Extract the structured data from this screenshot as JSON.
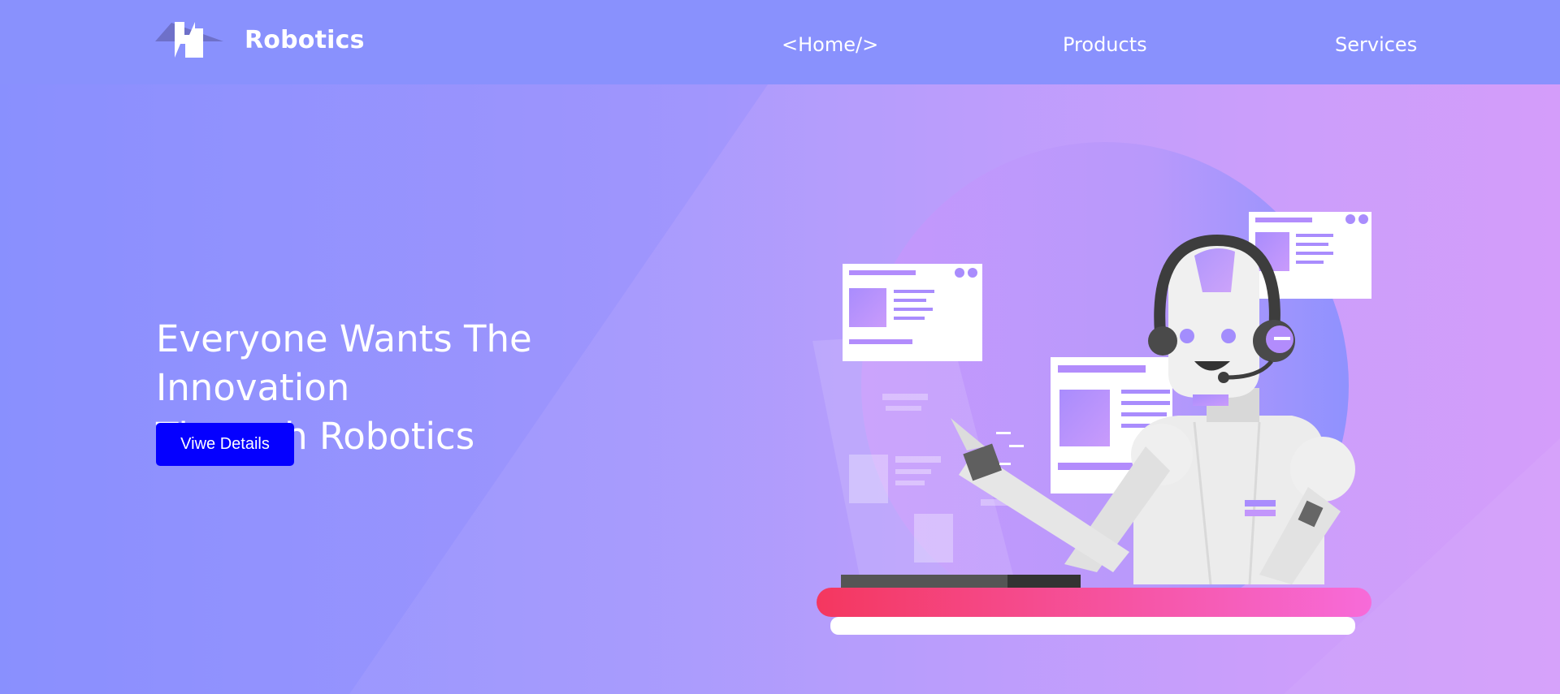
{
  "brand": {
    "name": "Robotics",
    "logo_icon": "robotics-logo-icon"
  },
  "nav": {
    "items": [
      {
        "label": "<Home/>"
      },
      {
        "label": "Products"
      },
      {
        "label": "Services"
      }
    ]
  },
  "hero": {
    "title_line1": "Everyone Wants The Innovation",
    "title_line2": "Through Robotics",
    "cta_label": "Viwe Details"
  },
  "illustration": {
    "icon": "robot-support-agent-icon"
  },
  "colors": {
    "header_bg": "#8991fd",
    "cta_bg": "#0500ff",
    "desk_gradient_start": "#f4375f",
    "desk_gradient_end": "#f76bd9"
  }
}
